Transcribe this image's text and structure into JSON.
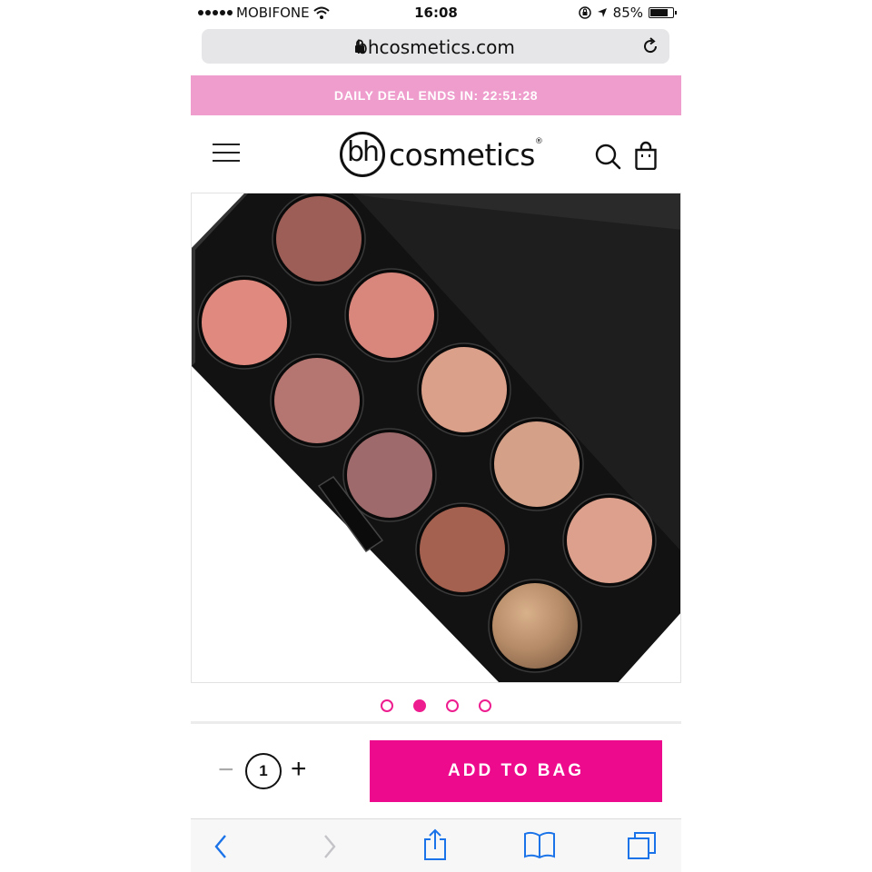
{
  "status_bar": {
    "carrier": "MOBIFONE",
    "time": "16:08",
    "battery": "85%",
    "battery_level": 0.85,
    "icons": [
      "signal-icon",
      "wifi-icon",
      "orientation-lock-icon",
      "location-icon",
      "battery-icon"
    ]
  },
  "browser": {
    "url": "bhcosmetics.com",
    "icons": [
      "lock-icon",
      "reload-icon"
    ]
  },
  "banner": {
    "text": "DAILY DEAL ENDS IN: 22:51:28"
  },
  "header": {
    "logo_mark": "bh",
    "logo_word": "cosmetics",
    "logo_reg": "®",
    "icons": [
      "menu-icon",
      "search-icon",
      "shopping-bag-icon"
    ]
  },
  "product": {
    "image_description_icon": "eyeshadow-palette-image",
    "palette_colors": [
      "#9c5e57",
      "#e08a7f",
      "#d9867c",
      "#b57671",
      "#daa08a",
      "#9e6a6b",
      "#d4a088",
      "#a5614f",
      "#dda08c",
      "#b58a6a"
    ]
  },
  "carousel": {
    "count": 4,
    "active_index": 1,
    "accent": "#ee1d8f"
  },
  "purchase": {
    "minus_label": "−",
    "quantity": "1",
    "plus_label": "+",
    "add_label": "ADD TO BAG",
    "button_color": "#ee0a8c"
  },
  "toolbar": {
    "icons": [
      "back-icon",
      "forward-icon",
      "share-icon",
      "bookmarks-icon",
      "tabs-icon"
    ]
  }
}
